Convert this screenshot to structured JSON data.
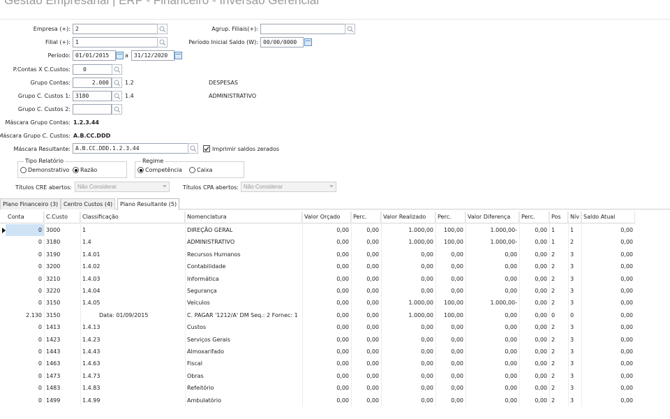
{
  "window": {
    "title": "Gestão Empresarial | ERP - Financeiro - Inversão Gerencial"
  },
  "form": {
    "empresa_label": "Empresa (+):",
    "empresa_value": "2",
    "filial_label": "Filial (+):",
    "filial_value": "1",
    "agrup_label": "Agrup. Filiais(+):",
    "agrup_value": "",
    "periodo_label": "Período:",
    "periodo_inicio": "01/01/2015",
    "periodo_sep": "a",
    "periodo_fim": "31/12/2020",
    "periodo_saldo_label": "Período Inicial Saldo (W):",
    "periodo_saldo_value": "00/00/0000",
    "pcontas_label": "P.Contas X C.Custos:",
    "pcontas_value": "0",
    "grupo_contas_label": "Grupo Contas:",
    "grupo_contas_value": "2.000",
    "grupo_contas_code": "1.2",
    "grupo_contas_desc": "DESPESAS",
    "grupo_cc1_label": "Grupo C. Custos 1:",
    "grupo_cc1_value": "3180",
    "grupo_cc1_code": "1.4",
    "grupo_cc1_desc": "ADMINISTRATIVO",
    "grupo_cc2_label": "Grupo C. Custos 2:",
    "grupo_cc2_value": "",
    "mascara_grupo_contas_label": "Máscara Grupo Contas:",
    "mascara_grupo_contas_value": "1.2.3.44",
    "mascara_grupo_cc_label": "Máscara Grupo C. Custos:",
    "mascara_grupo_cc_value": "A.B.CC.DDD",
    "mascara_resultante_label": "Máscara Resultante:",
    "mascara_resultante_value": "A.B.CC.DDD.1.2.3.44",
    "imprimir_label": "Imprimir saldos zerados",
    "imprimir_checked": true,
    "tipo_relatorio_label": "Tipo Relatório",
    "tipo_demonstrativo": "Demonstrativo",
    "tipo_razao": "Razão",
    "regime_label": "Regime",
    "regime_competencia": "Competência",
    "regime_caixa": "Caixa",
    "titulos_cre_label": "Títulos CRE abertos:",
    "titulos_cre_value": "Não Considerar",
    "titulos_cpa_label": "Títulos CPA abertos:",
    "titulos_cpa_value": "Não Considerar"
  },
  "tabs": [
    {
      "label": "Plano Financeiro (3)"
    },
    {
      "label": "Centro Custos (4)"
    },
    {
      "label": "Plano Resultante (5)"
    }
  ],
  "table": {
    "headers": [
      "Conta",
      "C.Custo",
      "Classificação",
      "Nomenclatura",
      "Valor Orçado",
      "Perc.",
      "Valor Realizado",
      "Perc.",
      "Valor Diferença",
      "Perc.",
      "Pos",
      "Nív",
      "Saldo Atual"
    ],
    "rows": [
      [
        "0",
        "3000",
        "1",
        "DIREÇÃO GERAL",
        "0,00",
        "0,00",
        "1.000,00",
        "100,00",
        "1.000,00-",
        "0,00",
        "1",
        "1",
        "0,00"
      ],
      [
        "0",
        "3180",
        "1.4",
        "ADMINISTRATIVO",
        "0,00",
        "0,00",
        "1.000,00",
        "100,00",
        "1.000,00-",
        "0,00",
        "1",
        "2",
        "0,00"
      ],
      [
        "0",
        "3190",
        "1.4.01",
        "Recursos Humanos",
        "0,00",
        "0,00",
        "0,00",
        "0,00",
        "0,00",
        "0,00",
        "2",
        "3",
        "0,00"
      ],
      [
        "0",
        "3200",
        "1.4.02",
        "Contabilidade",
        "0,00",
        "0,00",
        "0,00",
        "0,00",
        "0,00",
        "0,00",
        "2",
        "3",
        "0,00"
      ],
      [
        "0",
        "3210",
        "1.4.03",
        "Informática",
        "0,00",
        "0,00",
        "0,00",
        "0,00",
        "0,00",
        "0,00",
        "2",
        "3",
        "0,00"
      ],
      [
        "0",
        "3220",
        "1.4.04",
        "Segurança",
        "0,00",
        "0,00",
        "0,00",
        "0,00",
        "0,00",
        "0,00",
        "2",
        "3",
        "0,00"
      ],
      [
        "0",
        "3150",
        "1.4.05",
        "Veículos",
        "0,00",
        "0,00",
        "1.000,00",
        "100,00",
        "1.000,00-",
        "0,00",
        "2",
        "3",
        "0,00"
      ],
      [
        "2.130",
        "3150",
        "Data: 01/09/2015",
        "C. PAGAR '1212/A' DM  Seq.: 2 Fornec: 1",
        "0,00",
        "0,00",
        "1.000,00",
        "100,00",
        "0,00",
        "0,00",
        "0",
        "0",
        "0,00"
      ],
      [
        "0",
        "1413",
        "1.4.13",
        "Custos",
        "0,00",
        "0,00",
        "0,00",
        "0,00",
        "0,00",
        "0,00",
        "2",
        "3",
        "0,00"
      ],
      [
        "0",
        "1423",
        "1.4.23",
        "Serviços Gerais",
        "0,00",
        "0,00",
        "0,00",
        "0,00",
        "0,00",
        "0,00",
        "2",
        "3",
        "0,00"
      ],
      [
        "0",
        "1443",
        "1.4.43",
        "Almoxarifado",
        "0,00",
        "0,00",
        "0,00",
        "0,00",
        "0,00",
        "0,00",
        "2",
        "3",
        "0,00"
      ],
      [
        "0",
        "1463",
        "1.4.63",
        "Fiscal",
        "0,00",
        "0,00",
        "0,00",
        "0,00",
        "0,00",
        "0,00",
        "2",
        "3",
        "0,00"
      ],
      [
        "0",
        "1473",
        "1.4.73",
        "Obras",
        "0,00",
        "0,00",
        "0,00",
        "0,00",
        "0,00",
        "0,00",
        "2",
        "3",
        "0,00"
      ],
      [
        "0",
        "1483",
        "1.4.83",
        "Refeitório",
        "0,00",
        "0,00",
        "0,00",
        "0,00",
        "0,00",
        "0,00",
        "2",
        "3",
        "0,00"
      ],
      [
        "0",
        "1499",
        "1.4.99",
        "Ambulatório",
        "0,00",
        "0,00",
        "0,00",
        "0,00",
        "0,00",
        "0,00",
        "2",
        "3",
        "0,00"
      ]
    ]
  }
}
